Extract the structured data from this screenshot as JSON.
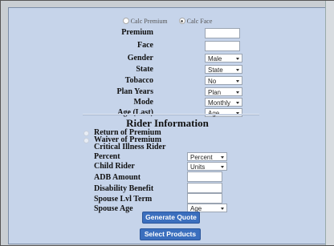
{
  "quote_type": {
    "options": [
      "Calc Premium",
      "Calc Face"
    ],
    "selected": "Calc Face"
  },
  "fields": {
    "premium_label": "Premium",
    "face_label": "Face",
    "gender_label": "Gender",
    "gender_value": "Male",
    "state_label": "State",
    "state_value": "State",
    "tobacco_label": "Tobacco",
    "tobacco_value": "No",
    "plan_years_label": "Plan Years",
    "plan_years_value": "Plan",
    "mode_label": "Mode",
    "mode_value": "Monthly",
    "age_label": "Age (Last)",
    "age_value": "Age"
  },
  "rider": {
    "title": "Rider Information",
    "return_premium_label": "Return of Premium",
    "waiver_premium_label": "Waiver of Premium",
    "critical_illness_label": "Critical Illness Rider",
    "percent_label": "Percent",
    "percent_value": "Percent",
    "child_rider_label": "Child Rider",
    "child_rider_value": "Units",
    "adb_amount_label": "ADB Amount",
    "disability_benefit_label": "Disability Benefit",
    "spouse_lvl_term_label": "Spouse Lvl Term",
    "spouse_age_label": "Spouse Age",
    "spouse_age_value": "Age"
  },
  "buttons": {
    "generate_quote": "Generate Quote",
    "select_products": "Select Products"
  }
}
